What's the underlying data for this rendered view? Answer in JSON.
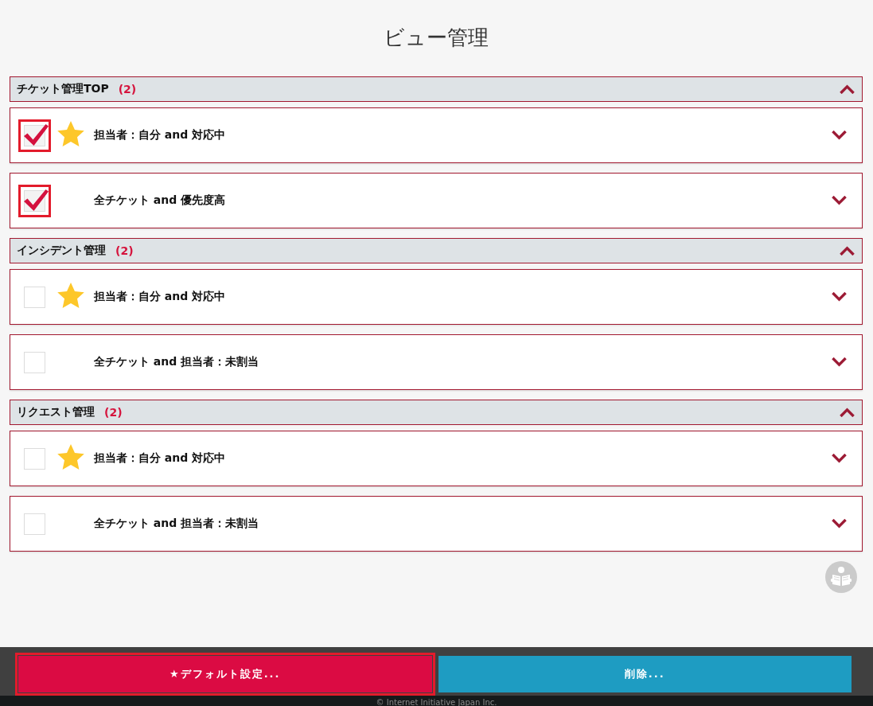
{
  "title": "ビュー管理",
  "groups": [
    {
      "name": "チケット管理TOP",
      "count": "(2)",
      "expanded": true,
      "views": [
        {
          "label": "担当者：自分 and 対応中",
          "checked": true,
          "highlighted": true,
          "starred": true,
          "expanded": false
        },
        {
          "label": "全チケット and 優先度高",
          "checked": true,
          "highlighted": true,
          "starred": false,
          "expanded": false
        }
      ]
    },
    {
      "name": "インシデント管理",
      "count": "(2)",
      "expanded": true,
      "views": [
        {
          "label": "担当者：自分 and 対応中",
          "checked": false,
          "highlighted": false,
          "starred": true,
          "expanded": false
        },
        {
          "label": "全チケット and 担当者：未割当",
          "checked": false,
          "highlighted": false,
          "starred": false,
          "expanded": false
        }
      ]
    },
    {
      "name": "リクエスト管理",
      "count": "(2)",
      "expanded": true,
      "views": [
        {
          "label": "担当者：自分 and 対応中",
          "checked": false,
          "highlighted": false,
          "starred": true,
          "expanded": false
        },
        {
          "label": "全チケット and 担当者：未割当",
          "checked": false,
          "highlighted": false,
          "starred": false,
          "expanded": false
        }
      ]
    }
  ],
  "buttons": [
    {
      "label": "★デフォルト設定...",
      "kind": "primary",
      "highlighted": true
    },
    {
      "label": "削除...",
      "kind": "secondary",
      "highlighted": false
    }
  ],
  "footer": "© Internet Initiative Japan Inc."
}
